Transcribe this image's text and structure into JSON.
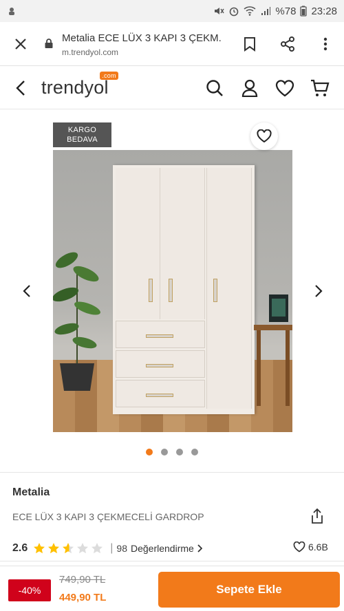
{
  "status_bar": {
    "battery": "%78",
    "time": "23:28"
  },
  "browser": {
    "page_title": "Metalia ECE LÜX 3 KAPI 3 ÇEKM...",
    "url": "m.trendyol.com",
    "icons": [
      "close-icon",
      "lock-icon",
      "bookmark-icon",
      "share-icon",
      "more-vert-icon"
    ]
  },
  "header": {
    "logo": "trendyol",
    "logo_badge": ".com",
    "icons": [
      "back-icon",
      "search-icon",
      "user-icon",
      "heart-icon",
      "cart-icon"
    ]
  },
  "gallery": {
    "badge_line1": "KARGO",
    "badge_line2": "BEDAVA",
    "image_count": 4,
    "active_index": 0
  },
  "product": {
    "brand": "Metalia",
    "name": "ECE LÜX 3 KAPI 3 ÇEKMECELİ GARDROP",
    "rating": "2.6",
    "rating_value": 2.6,
    "stars_total": 5,
    "separator": "|",
    "review_count": "98",
    "review_label": "Değerlendirme",
    "likes": "6.6B"
  },
  "bottom": {
    "discount": "-40%",
    "old_price": "749,90 TL",
    "new_price": "449,90 TL",
    "add_to_cart": "Sepete Ekle"
  },
  "colors": {
    "accent": "#f27a1a",
    "discount_bg": "#d0021b",
    "star": "#ffc000"
  }
}
